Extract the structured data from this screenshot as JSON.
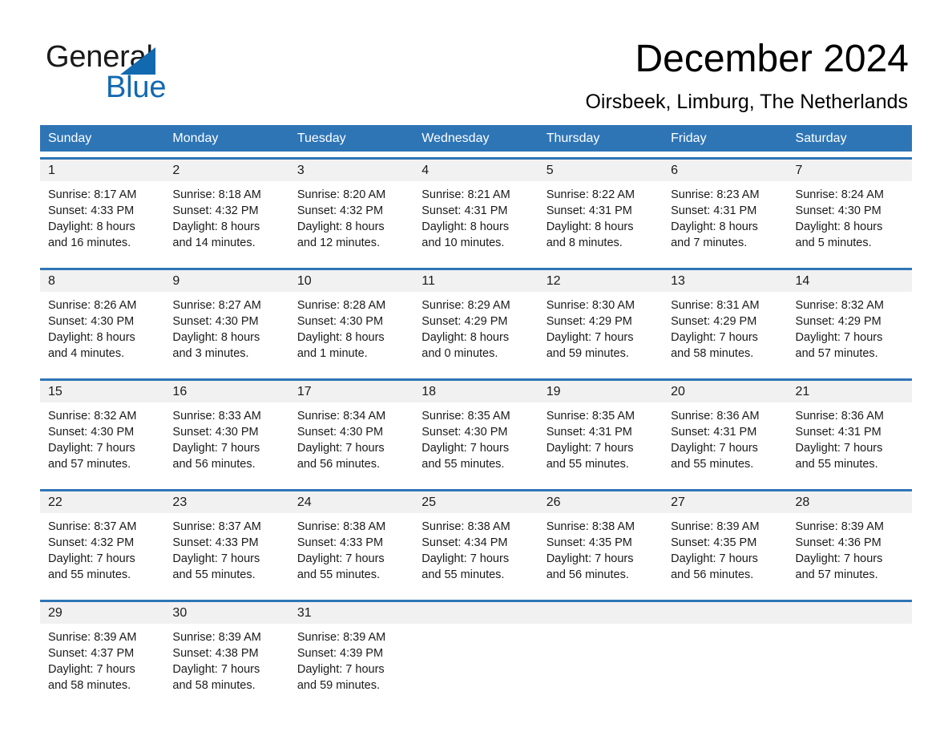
{
  "brand": {
    "name_top": "General",
    "name_bottom": "Blue",
    "accent_color": "#1169b0"
  },
  "header": {
    "title": "December 2024",
    "subtitle": "Oirsbeek, Limburg, The Netherlands"
  },
  "theme": {
    "header_blue": "#2e75b6",
    "daynum_band": "#f1f1f1",
    "text": "#1a1a1a"
  },
  "weekday_headers": [
    "Sunday",
    "Monday",
    "Tuesday",
    "Wednesday",
    "Thursday",
    "Friday",
    "Saturday"
  ],
  "weeks": [
    {
      "days": [
        {
          "num": "1",
          "line1": "Sunrise: 8:17 AM",
          "line2": "Sunset: 4:33 PM",
          "line3": "Daylight: 8 hours",
          "line4": "and 16 minutes."
        },
        {
          "num": "2",
          "line1": "Sunrise: 8:18 AM",
          "line2": "Sunset: 4:32 PM",
          "line3": "Daylight: 8 hours",
          "line4": "and 14 minutes."
        },
        {
          "num": "3",
          "line1": "Sunrise: 8:20 AM",
          "line2": "Sunset: 4:32 PM",
          "line3": "Daylight: 8 hours",
          "line4": "and 12 minutes."
        },
        {
          "num": "4",
          "line1": "Sunrise: 8:21 AM",
          "line2": "Sunset: 4:31 PM",
          "line3": "Daylight: 8 hours",
          "line4": "and 10 minutes."
        },
        {
          "num": "5",
          "line1": "Sunrise: 8:22 AM",
          "line2": "Sunset: 4:31 PM",
          "line3": "Daylight: 8 hours",
          "line4": "and 8 minutes."
        },
        {
          "num": "6",
          "line1": "Sunrise: 8:23 AM",
          "line2": "Sunset: 4:31 PM",
          "line3": "Daylight: 8 hours",
          "line4": "and 7 minutes."
        },
        {
          "num": "7",
          "line1": "Sunrise: 8:24 AM",
          "line2": "Sunset: 4:30 PM",
          "line3": "Daylight: 8 hours",
          "line4": "and 5 minutes."
        }
      ]
    },
    {
      "days": [
        {
          "num": "8",
          "line1": "Sunrise: 8:26 AM",
          "line2": "Sunset: 4:30 PM",
          "line3": "Daylight: 8 hours",
          "line4": "and 4 minutes."
        },
        {
          "num": "9",
          "line1": "Sunrise: 8:27 AM",
          "line2": "Sunset: 4:30 PM",
          "line3": "Daylight: 8 hours",
          "line4": "and 3 minutes."
        },
        {
          "num": "10",
          "line1": "Sunrise: 8:28 AM",
          "line2": "Sunset: 4:30 PM",
          "line3": "Daylight: 8 hours",
          "line4": "and 1 minute."
        },
        {
          "num": "11",
          "line1": "Sunrise: 8:29 AM",
          "line2": "Sunset: 4:29 PM",
          "line3": "Daylight: 8 hours",
          "line4": "and 0 minutes."
        },
        {
          "num": "12",
          "line1": "Sunrise: 8:30 AM",
          "line2": "Sunset: 4:29 PM",
          "line3": "Daylight: 7 hours",
          "line4": "and 59 minutes."
        },
        {
          "num": "13",
          "line1": "Sunrise: 8:31 AM",
          "line2": "Sunset: 4:29 PM",
          "line3": "Daylight: 7 hours",
          "line4": "and 58 minutes."
        },
        {
          "num": "14",
          "line1": "Sunrise: 8:32 AM",
          "line2": "Sunset: 4:29 PM",
          "line3": "Daylight: 7 hours",
          "line4": "and 57 minutes."
        }
      ]
    },
    {
      "days": [
        {
          "num": "15",
          "line1": "Sunrise: 8:32 AM",
          "line2": "Sunset: 4:30 PM",
          "line3": "Daylight: 7 hours",
          "line4": "and 57 minutes."
        },
        {
          "num": "16",
          "line1": "Sunrise: 8:33 AM",
          "line2": "Sunset: 4:30 PM",
          "line3": "Daylight: 7 hours",
          "line4": "and 56 minutes."
        },
        {
          "num": "17",
          "line1": "Sunrise: 8:34 AM",
          "line2": "Sunset: 4:30 PM",
          "line3": "Daylight: 7 hours",
          "line4": "and 56 minutes."
        },
        {
          "num": "18",
          "line1": "Sunrise: 8:35 AM",
          "line2": "Sunset: 4:30 PM",
          "line3": "Daylight: 7 hours",
          "line4": "and 55 minutes."
        },
        {
          "num": "19",
          "line1": "Sunrise: 8:35 AM",
          "line2": "Sunset: 4:31 PM",
          "line3": "Daylight: 7 hours",
          "line4": "and 55 minutes."
        },
        {
          "num": "20",
          "line1": "Sunrise: 8:36 AM",
          "line2": "Sunset: 4:31 PM",
          "line3": "Daylight: 7 hours",
          "line4": "and 55 minutes."
        },
        {
          "num": "21",
          "line1": "Sunrise: 8:36 AM",
          "line2": "Sunset: 4:31 PM",
          "line3": "Daylight: 7 hours",
          "line4": "and 55 minutes."
        }
      ]
    },
    {
      "days": [
        {
          "num": "22",
          "line1": "Sunrise: 8:37 AM",
          "line2": "Sunset: 4:32 PM",
          "line3": "Daylight: 7 hours",
          "line4": "and 55 minutes."
        },
        {
          "num": "23",
          "line1": "Sunrise: 8:37 AM",
          "line2": "Sunset: 4:33 PM",
          "line3": "Daylight: 7 hours",
          "line4": "and 55 minutes."
        },
        {
          "num": "24",
          "line1": "Sunrise: 8:38 AM",
          "line2": "Sunset: 4:33 PM",
          "line3": "Daylight: 7 hours",
          "line4": "and 55 minutes."
        },
        {
          "num": "25",
          "line1": "Sunrise: 8:38 AM",
          "line2": "Sunset: 4:34 PM",
          "line3": "Daylight: 7 hours",
          "line4": "and 55 minutes."
        },
        {
          "num": "26",
          "line1": "Sunrise: 8:38 AM",
          "line2": "Sunset: 4:35 PM",
          "line3": "Daylight: 7 hours",
          "line4": "and 56 minutes."
        },
        {
          "num": "27",
          "line1": "Sunrise: 8:39 AM",
          "line2": "Sunset: 4:35 PM",
          "line3": "Daylight: 7 hours",
          "line4": "and 56 minutes."
        },
        {
          "num": "28",
          "line1": "Sunrise: 8:39 AM",
          "line2": "Sunset: 4:36 PM",
          "line3": "Daylight: 7 hours",
          "line4": "and 57 minutes."
        }
      ]
    },
    {
      "days": [
        {
          "num": "29",
          "line1": "Sunrise: 8:39 AM",
          "line2": "Sunset: 4:37 PM",
          "line3": "Daylight: 7 hours",
          "line4": "and 58 minutes."
        },
        {
          "num": "30",
          "line1": "Sunrise: 8:39 AM",
          "line2": "Sunset: 4:38 PM",
          "line3": "Daylight: 7 hours",
          "line4": "and 58 minutes."
        },
        {
          "num": "31",
          "line1": "Sunrise: 8:39 AM",
          "line2": "Sunset: 4:39 PM",
          "line3": "Daylight: 7 hours",
          "line4": "and 59 minutes."
        },
        {
          "num": "",
          "line1": "",
          "line2": "",
          "line3": "",
          "line4": ""
        },
        {
          "num": "",
          "line1": "",
          "line2": "",
          "line3": "",
          "line4": ""
        },
        {
          "num": "",
          "line1": "",
          "line2": "",
          "line3": "",
          "line4": ""
        },
        {
          "num": "",
          "line1": "",
          "line2": "",
          "line3": "",
          "line4": ""
        }
      ]
    }
  ]
}
